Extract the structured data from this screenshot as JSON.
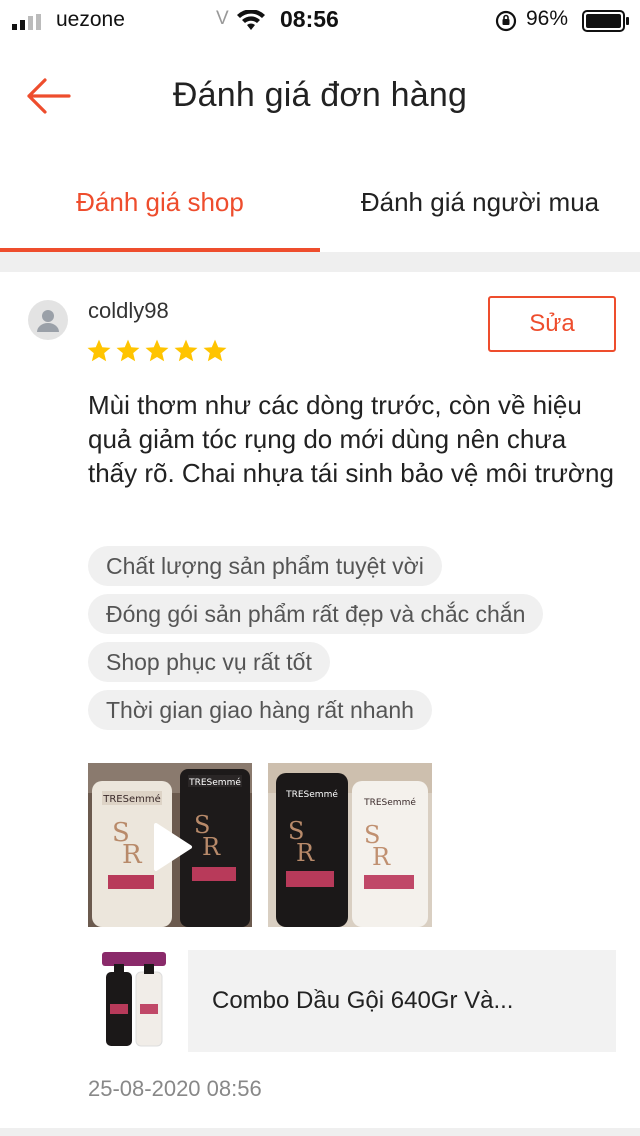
{
  "status_bar": {
    "carrier": "uezone",
    "network": "V",
    "time": "08:56",
    "battery": "96%"
  },
  "header": {
    "title": "Đánh giá đơn hàng",
    "back_icon": "arrow-left-icon"
  },
  "tabs": [
    {
      "label": "Đánh giá shop",
      "active": true
    },
    {
      "label": "Đánh giá người mua",
      "active": false
    }
  ],
  "review": {
    "username": "coldly98",
    "rating": 5,
    "edit_label": "Sửa",
    "text": "Mùi thơm như các dòng trước, còn về hiệu quả giảm tóc rụng do mới dùng nên chưa thấy rõ. Chai nhựa tái sinh bảo vệ môi trường",
    "chips": [
      "Chất lượng sản phẩm tuyệt vời",
      "Đóng gói sản phẩm rất đẹp và chắc chắn",
      "Shop phục vụ rất tốt",
      "Thời gian giao hàng rất nhanh"
    ],
    "product": {
      "name": "Combo Dầu Gội 640Gr Và..."
    },
    "timestamp": "25-08-2020 08:56"
  },
  "colors": {
    "accent": "#ee4d2d",
    "star": "#ffc400"
  }
}
